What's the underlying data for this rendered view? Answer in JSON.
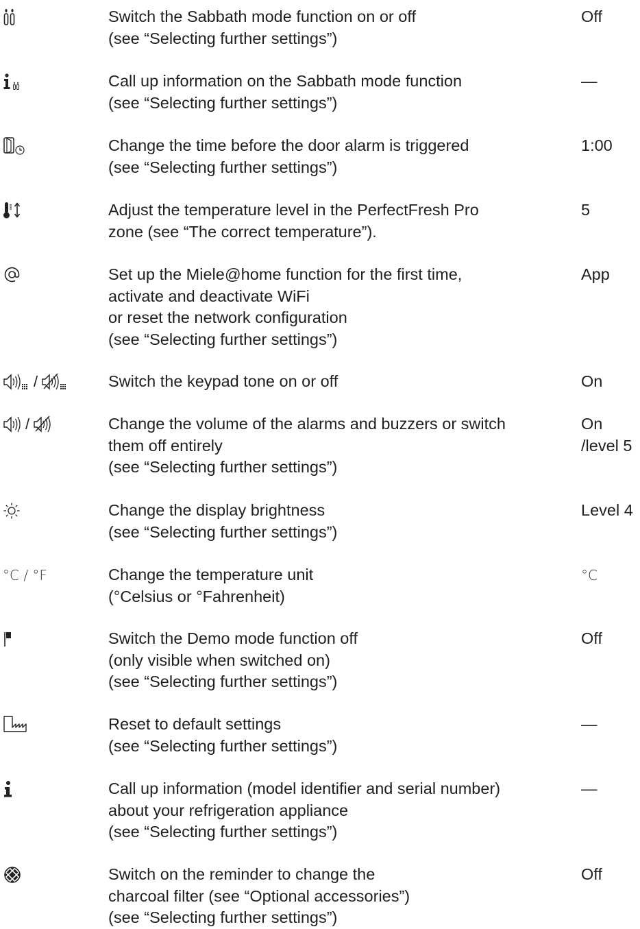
{
  "rows": [
    {
      "icon": "sabbath-icon",
      "description": "Switch the Sabbath mode function on or off\n(see “Selecting further settings”)",
      "value": "Off"
    },
    {
      "icon": "sabbath-info-icon",
      "description": "Call up information on the Sabbath mode function\n(see “Selecting further settings”)",
      "value": "—"
    },
    {
      "icon": "door-alarm-timer-icon",
      "description": "Change the time before the door alarm is triggered\n(see “Selecting further settings”)",
      "value": "1:00"
    },
    {
      "icon": "temperature-level-icon",
      "description": "Adjust the temperature level in the PerfectFresh Pro\nzone (see “The correct temperature”).",
      "value": "5"
    },
    {
      "icon": "at-sign-icon",
      "description": "Set up the Miele@home function for the first time,\nactivate and deactivate WiFi\nor reset the network configuration\n(see “Selecting further settings”)",
      "value": "App"
    },
    {
      "icon": "keypad-tone-icon",
      "symbol_separator": "/",
      "description": "Switch the keypad tone on or off",
      "value": "On"
    },
    {
      "icon": "volume-icon",
      "symbol_separator": "/",
      "description": "Change the volume of the alarms and buzzers or switch\nthem off entirely\n(see “Selecting further settings”)",
      "value": "On\n/level 5"
    },
    {
      "icon": "brightness-icon",
      "description": "Change the display brightness\n(see “Selecting further settings”)",
      "value": "Level 4"
    },
    {
      "icon": "temperature-unit-icon",
      "symbol_text": "°C / °F",
      "description": "Change the temperature unit\n(°Celsius or °Fahrenheit)",
      "value": "°C"
    },
    {
      "icon": "demo-flag-icon",
      "description": "Switch the Demo mode function off\n(only visible when switched on)\n(see “Selecting further settings”)",
      "value": "Off"
    },
    {
      "icon": "factory-reset-icon",
      "description": "Reset to default settings\n(see “Selecting further settings”)",
      "value": "—"
    },
    {
      "icon": "info-icon",
      "description": "Call up information (model identifier and serial number)\nabout your refrigeration appliance\n(see “Selecting further settings”)",
      "value": "—"
    },
    {
      "icon": "charcoal-filter-icon",
      "description": "Switch on the reminder to change the\ncharcoal filter (see “Optional accessories”)\n(see “Selecting further settings”)",
      "value": "Off"
    }
  ]
}
